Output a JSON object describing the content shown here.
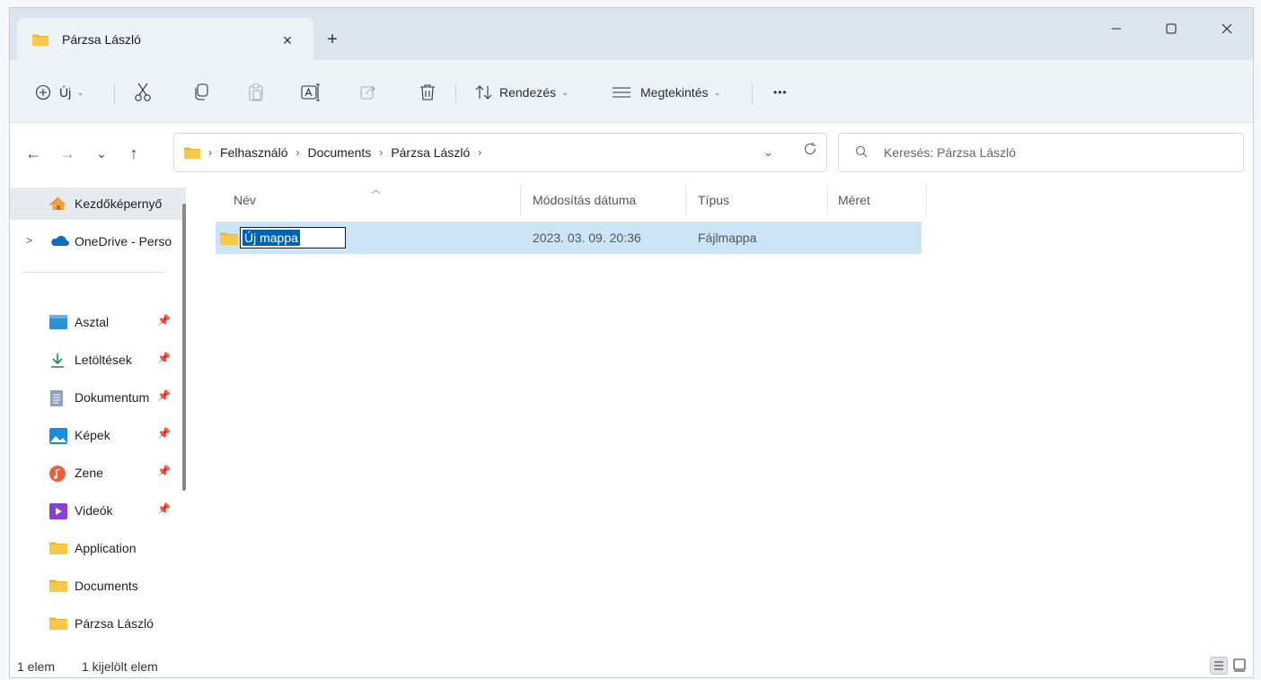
{
  "window": {
    "tab_title": "Párzsa László",
    "new_tab": "+",
    "close_tab": "×",
    "controls": {
      "minimize": "—",
      "maximize": "☐",
      "close": "✕"
    }
  },
  "commandbar": {
    "new_label": "Új",
    "sort_label": "Rendezés",
    "view_label": "Megtekintés",
    "more_label": "•••",
    "icons": [
      "add-icon",
      "cut-icon",
      "copy-icon",
      "paste-icon",
      "rename-icon",
      "share-icon",
      "delete-icon",
      "sort-icon",
      "view-icon",
      "more-icon"
    ]
  },
  "nav": {
    "back": "←",
    "forward": "→",
    "recent": "⌄",
    "up": "↑"
  },
  "address": {
    "crumbs": [
      "Felhasználó",
      "Documents",
      "Párzsa László"
    ],
    "separator": "›"
  },
  "search": {
    "placeholder": "Keresés: Párzsa László"
  },
  "sidebar": {
    "items": [
      {
        "label": "Kezdőképernyő",
        "icon": "home-icon",
        "selected": true
      },
      {
        "label": "OneDrive - Perso",
        "icon": "cloud-icon",
        "expander": ">"
      },
      {
        "label": "Asztal",
        "icon": "desktop-icon",
        "pinned": true
      },
      {
        "label": "Letöltések",
        "icon": "download-icon",
        "pinned": true
      },
      {
        "label": "Dokumentum",
        "icon": "document-icon",
        "pinned": true
      },
      {
        "label": "Képek",
        "icon": "pictures-icon",
        "pinned": true
      },
      {
        "label": "Zene",
        "icon": "music-icon",
        "pinned": true
      },
      {
        "label": "Videók",
        "icon": "videos-icon",
        "pinned": true
      },
      {
        "label": "Application",
        "icon": "folder-icon"
      },
      {
        "label": "Documents",
        "icon": "folder-icon"
      },
      {
        "label": "Párzsa László",
        "icon": "folder-icon"
      }
    ],
    "pin_glyph": "📌"
  },
  "filelist": {
    "columns": {
      "name": "Név",
      "modified": "Módosítás dátuma",
      "type": "Típus",
      "size": "Méret"
    },
    "rows": [
      {
        "name": "Új mappa",
        "modified": "2023. 03. 09. 20:36",
        "type": "Fájlmappa",
        "size": ""
      }
    ]
  },
  "status": {
    "count": "1 elem",
    "selected": "1 kijelölt elem"
  },
  "colors": {
    "folder": "#f7c948",
    "selection": "#cce4f7",
    "accent": "#0063b1"
  }
}
